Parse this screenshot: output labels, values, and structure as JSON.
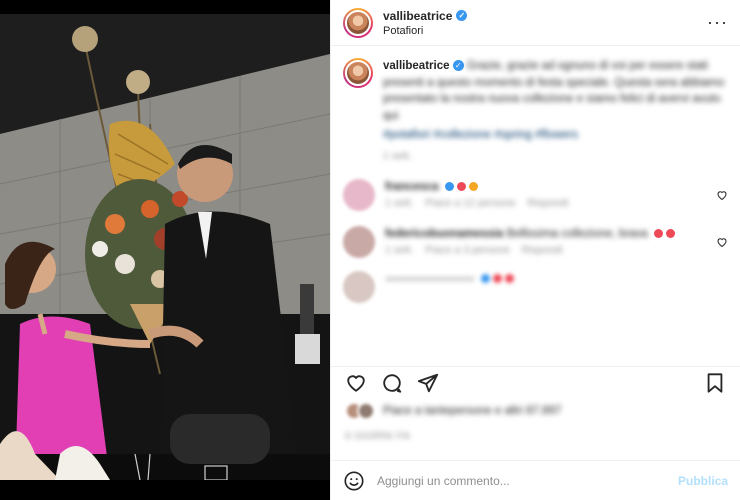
{
  "post": {
    "username": "vallibeatrice",
    "location": "Potafiori",
    "more_label": "···"
  },
  "caption": {
    "username": "vallibeatrice",
    "text": "Grazie, grazie ad ognuno di voi per essere stati presenti a questo momento di festa speciale. Questa sera abbiamo presentato la nostra nuova collezione e siamo felici di avervi avuto qui",
    "hashtags": "#potafiori #collezione #spring #flowers",
    "time": "1 sett."
  },
  "comments": [
    {
      "user": "francesca",
      "text": "",
      "time": "1 sett.",
      "likes": "Piace a 12 persone",
      "reply": "Rispondi",
      "avatar_color": "#e7b8c9",
      "emoji_colors": [
        "#3897f0",
        "#ed4956",
        "#f5a623"
      ]
    },
    {
      "user": "federicobuonamessia",
      "text": "Bellissima collezione, brava",
      "time": "1 sett.",
      "likes": "Piace a 3 persone",
      "reply": "Rispondi",
      "avatar_color": "#c9a9a6",
      "emoji_colors": [
        "#ed4956",
        "#ed4956"
      ]
    },
    {
      "user": "",
      "text": "",
      "time": "",
      "likes": "",
      "reply": "",
      "avatar_color": "#d8c7c2",
      "emoji_colors": [
        "#3897f0",
        "#ed4956",
        "#ed4956"
      ]
    }
  ],
  "likes_text": "Piace a tantepersone e altri 87.897",
  "date": "6 GIORNI FA",
  "add_comment": {
    "placeholder": "Aggiungi un commento...",
    "publish_label": "Pubblica"
  },
  "colors": {
    "accent": "#3897f0",
    "publish_disabled": "#b2dffc",
    "dress": "#e23fb4"
  }
}
